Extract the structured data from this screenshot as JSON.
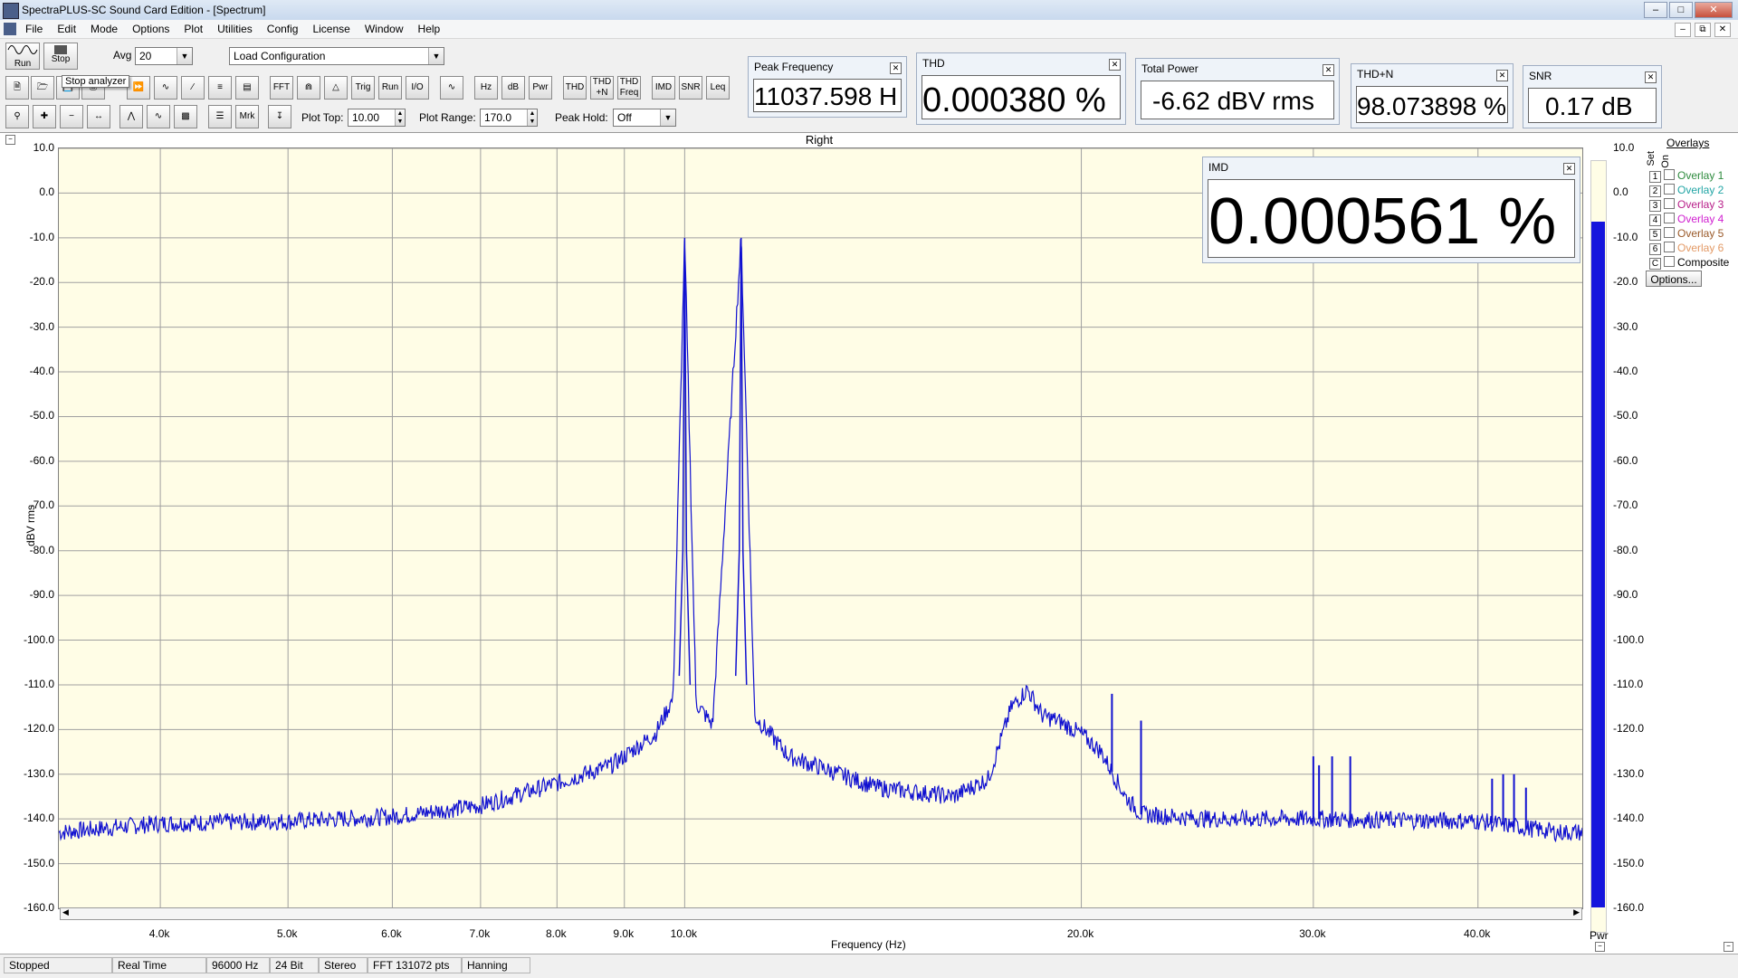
{
  "window": {
    "title": "SpectraPLUS-SC Sound Card Edition - [Spectrum]"
  },
  "menu": [
    "File",
    "Edit",
    "Mode",
    "Options",
    "Plot",
    "Utilities",
    "Config",
    "License",
    "Window",
    "Help"
  ],
  "toolbar": {
    "run_label": "Run",
    "stop_label": "Stop",
    "tooltip": "Stop analyzer",
    "avg_label": "Avg",
    "avg_value": "20",
    "load_config": "Load Configuration",
    "plot_top_label": "Plot Top:",
    "plot_top_value": "10.00",
    "plot_range_label": "Plot Range:",
    "plot_range_value": "170.0",
    "peak_hold_label": "Peak Hold:",
    "peak_hold_value": "Off",
    "row2_buttons": [
      "FFT",
      "Trig",
      "Run Ctrl",
      "I/O",
      "Hz",
      "dB",
      "Pwr",
      "THD",
      "THD +N",
      "THD Freq",
      "IMD",
      "SNR",
      "Leq"
    ],
    "row3_buttons": [
      "Mrk"
    ]
  },
  "meters": {
    "peak_frequency": {
      "title": "Peak Frequency",
      "value": "11037.598 H"
    },
    "thd": {
      "title": "THD",
      "value": "0.000380 %"
    },
    "total_power": {
      "title": "Total Power",
      "value": "-6.62 dBV rms"
    },
    "thd_n": {
      "title": "THD+N",
      "value": "98.073898 %"
    },
    "snr": {
      "title": "SNR",
      "value": "0.17 dB"
    },
    "imd": {
      "title": "IMD",
      "value": "0.000561 %"
    }
  },
  "plot": {
    "channel": "Right",
    "ylabel": "dBV rms",
    "xlabel": "Frequency (Hz)",
    "pwr_label": "Pwr",
    "pwr_level_dbv": -6.62,
    "y_ticks": [
      "10.0",
      "0.0",
      "-10.0",
      "-20.0",
      "-30.0",
      "-40.0",
      "-50.0",
      "-60.0",
      "-70.0",
      "-80.0",
      "-90.0",
      "-100.0",
      "-110.0",
      "-120.0",
      "-130.0",
      "-140.0",
      "-150.0",
      "-160.0"
    ],
    "x_ticks": [
      "4.0k",
      "5.0k",
      "6.0k",
      "7.0k",
      "8.0k",
      "9.0k",
      "10.0k",
      "20.0k",
      "30.0k",
      "40.0k"
    ]
  },
  "overlays": {
    "title": "Overlays",
    "set_label": "Set",
    "on_label": "On",
    "items": [
      {
        "num": "1",
        "name": "Overlay 1",
        "color": "#2e8b3e"
      },
      {
        "num": "2",
        "name": "Overlay 2",
        "color": "#22a5a5"
      },
      {
        "num": "3",
        "name": "Overlay 3",
        "color": "#b8208a"
      },
      {
        "num": "4",
        "name": "Overlay 4",
        "color": "#d020d0"
      },
      {
        "num": "5",
        "name": "Overlay 5",
        "color": "#9a5a2a"
      },
      {
        "num": "6",
        "name": "Overlay 6",
        "color": "#e39a66"
      },
      {
        "num": "C",
        "name": "Composite",
        "color": "#000000"
      }
    ],
    "options_button": "Options..."
  },
  "status": [
    "Stopped",
    "Real Time",
    "96000 Hz",
    "24 Bit",
    "Stereo",
    "FFT 131072 pts",
    "Hanning"
  ],
  "chart_data": {
    "type": "line",
    "title": "Right",
    "xlabel": "Frequency (Hz)",
    "ylabel": "dBV rms",
    "xscale": "log",
    "xlim": [
      3350,
      48000
    ],
    "ylim": [
      -160,
      10
    ],
    "grid": true,
    "series": [
      {
        "color": "#1010d0",
        "points": [
          [
            3350,
            -143
          ],
          [
            4000,
            -141
          ],
          [
            5000,
            -140.5
          ],
          [
            6000,
            -139.5
          ],
          [
            7000,
            -137
          ],
          [
            8000,
            -132
          ],
          [
            8800,
            -128
          ],
          [
            9500,
            -121
          ],
          [
            9800,
            -113
          ],
          [
            10000,
            -10
          ],
          [
            10200,
            -114
          ],
          [
            10500,
            -119
          ],
          [
            11037,
            -10
          ],
          [
            11300,
            -117
          ],
          [
            12000,
            -126
          ],
          [
            14000,
            -133
          ],
          [
            16000,
            -135
          ],
          [
            17000,
            -131
          ],
          [
            17700,
            -115
          ],
          [
            18200,
            -111
          ],
          [
            18700,
            -117
          ],
          [
            19200,
            -118
          ],
          [
            20000,
            -121
          ],
          [
            20700,
            -125
          ],
          [
            21600,
            -135
          ],
          [
            22200,
            -139
          ],
          [
            25000,
            -140
          ],
          [
            30000,
            -140
          ],
          [
            40000,
            -140.5
          ],
          [
            46000,
            -143
          ]
        ],
        "spikes": [
          [
            21100,
            -112
          ],
          [
            22200,
            -118
          ],
          [
            30000,
            -126
          ],
          [
            30300,
            -128
          ],
          [
            31000,
            -126
          ],
          [
            32000,
            -126
          ],
          [
            41000,
            -131
          ],
          [
            41800,
            -130
          ],
          [
            42600,
            -130
          ],
          [
            43500,
            -133
          ]
        ]
      }
    ]
  }
}
